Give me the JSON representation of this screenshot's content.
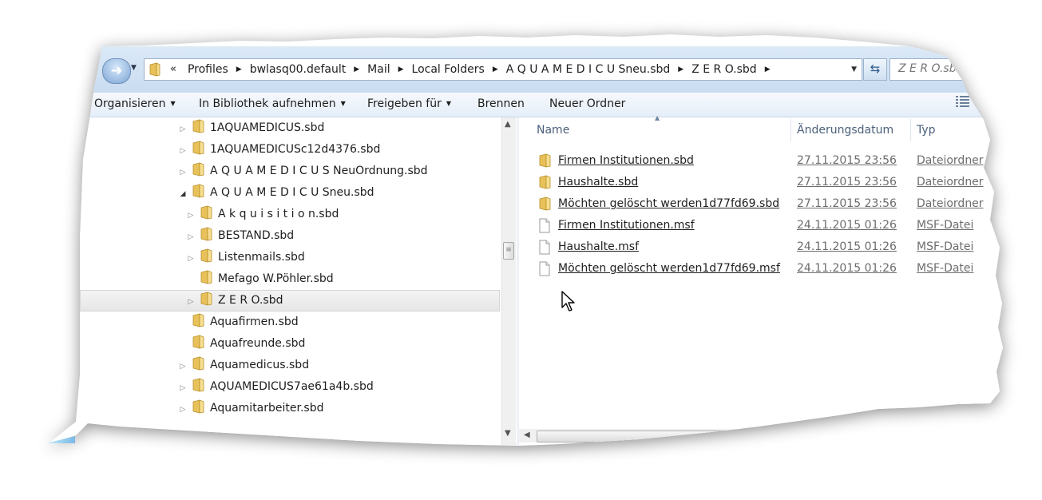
{
  "window": {
    "search_placeholder": "Z E R O.sbd",
    "breadcrumb": {
      "overflow": "«",
      "items": [
        "Profiles",
        "bwlasq00.default",
        "Mail",
        "Local Folders",
        "A Q U A M E D I C U Sneu.sbd",
        "Z E R O.sbd"
      ]
    }
  },
  "toolbar": {
    "organize": "Organisieren",
    "include_library": "In Bibliothek aufnehmen",
    "share": "Freigeben für",
    "burn": "Brennen",
    "new_folder": "Neuer Ordner"
  },
  "tree": {
    "items": [
      {
        "label": "1AQUAMEDICUS.sbd",
        "level": 0,
        "expander": "collapsed"
      },
      {
        "label": "1AQUAMEDICUSc12d4376.sbd",
        "level": 0,
        "expander": "collapsed"
      },
      {
        "label": "A Q U A M E D I C U S NeuOrdnung.sbd",
        "level": 0,
        "expander": "collapsed"
      },
      {
        "label": "A Q U A M E D I C U Sneu.sbd",
        "level": 0,
        "expander": "expanded"
      },
      {
        "label": "A k q u i s i t i o n.sbd",
        "level": 1,
        "expander": "collapsed"
      },
      {
        "label": "BESTAND.sbd",
        "level": 1,
        "expander": "collapsed"
      },
      {
        "label": "Listenmails.sbd",
        "level": 1,
        "expander": "collapsed"
      },
      {
        "label": "Mefago W.Pöhler.sbd",
        "level": 1,
        "expander": "none"
      },
      {
        "label": "Z E R O.sbd",
        "level": 1,
        "expander": "collapsed",
        "selected": true
      },
      {
        "label": "Aquafirmen.sbd",
        "level": 0,
        "expander": "none"
      },
      {
        "label": "Aquafreunde.sbd",
        "level": 0,
        "expander": "none"
      },
      {
        "label": "Aquamedicus.sbd",
        "level": 0,
        "expander": "collapsed"
      },
      {
        "label": "AQUAMEDICUS7ae61a4b.sbd",
        "level": 0,
        "expander": "collapsed"
      },
      {
        "label": "Aquamitarbeiter.sbd",
        "level": 0,
        "expander": "collapsed"
      }
    ]
  },
  "columns": {
    "name": "Name",
    "modified": "Änderungsdatum",
    "type": "Typ"
  },
  "files": [
    {
      "name": "Firmen Institutionen.sbd",
      "date": "27.11.2015 23:56",
      "type": "Dateiordner",
      "kind": "folder"
    },
    {
      "name": "Haushalte.sbd",
      "date": "27.11.2015 23:56",
      "type": "Dateiordner",
      "kind": "folder"
    },
    {
      "name": "Möchten gelöscht werden1d77fd69.sbd",
      "date": "27.11.2015 23:56",
      "type": "Dateiordner",
      "kind": "folder"
    },
    {
      "name": "Firmen Institutionen.msf",
      "date": "24.11.2015 01:26",
      "type": "MSF-Datei",
      "kind": "file"
    },
    {
      "name": "Haushalte.msf",
      "date": "24.11.2015 01:26",
      "type": "MSF-Datei",
      "kind": "file"
    },
    {
      "name": "Möchten gelöscht werden1d77fd69.msf",
      "date": "24.11.2015 01:26",
      "type": "MSF-Datei",
      "kind": "file"
    }
  ],
  "colors": {
    "addressbar": "#c9dcf0",
    "folder": "#e8c15a",
    "selection": "#e6e6e6"
  },
  "icons": {
    "back": "arrow-left-icon",
    "folder": "folder-icon",
    "file": "document-icon",
    "refresh": "refresh-icon",
    "view": "view-options-icon"
  }
}
